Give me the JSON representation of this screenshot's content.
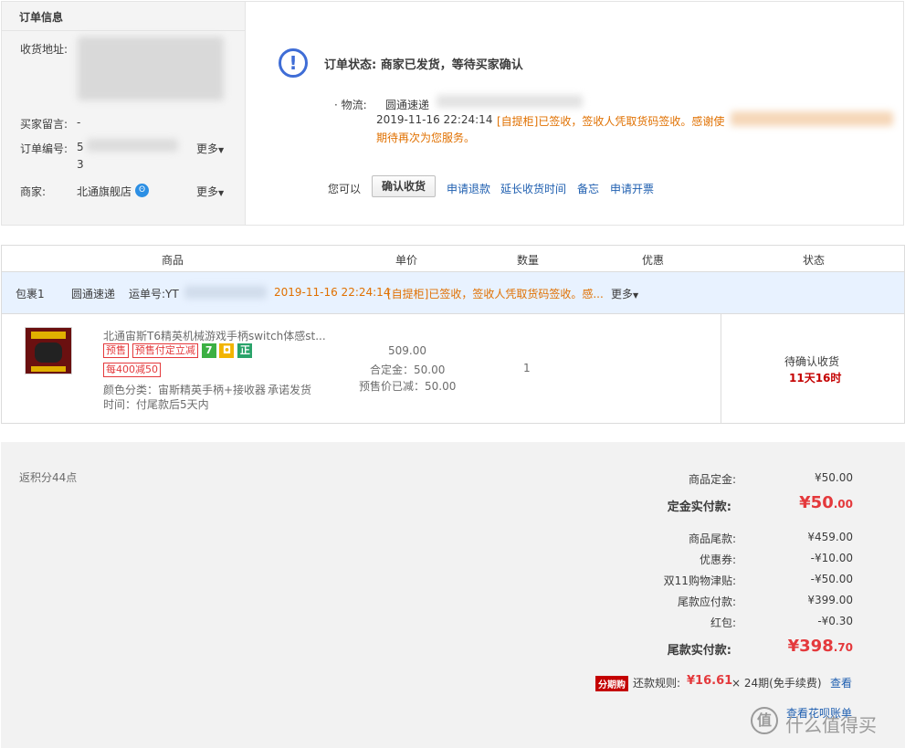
{
  "order_info": {
    "title": "订单信息",
    "address_label": "收货地址:",
    "message_label": "买家留言:",
    "message_value": "-",
    "order_no_label": "订单编号:",
    "order_no_prefix": "5",
    "order_no_tail": "3",
    "more_label": "更多",
    "seller_label": "商家:",
    "seller_value": "北通旗舰店",
    "seller_more": "更多"
  },
  "status": {
    "title": "订单状态: 商家已发货，等待买家确认",
    "logistics_label": "· 物流:",
    "logistics_company": "圆通速递",
    "logistics_time": "2019-11-16 22:24:14",
    "logistics_msg": "[自提柜]已签收，签收人凭取货码签收。感谢使",
    "logistics_msg2": "期待再次为您服务。",
    "you_can": "您可以",
    "confirm_button": "确认收货",
    "actions": [
      "申请退款",
      "延长收货时间",
      "备忘",
      "申请开票"
    ]
  },
  "table": {
    "headers": [
      "商品",
      "单价",
      "数量",
      "优惠",
      "状态"
    ],
    "package": {
      "label": "包裹1",
      "company": "圆通速递",
      "tracking_label": "运单号:YT",
      "time": "2019-11-16 22:24:14",
      "msg": "[自提柜]已签收，签收人凭取货码签收。感...",
      "more": "更多"
    },
    "item": {
      "name": "北通宙斯T6精英机械游戏手柄switch体感st...",
      "tag_presale": "预售",
      "tag_deposit": "预售付定立减",
      "icon7": "7",
      "iconZheng": "正",
      "promo": "每400减50",
      "spec": "颜色分类：宙斯精英手柄+接收器",
      "promise": "承诺发货",
      "time": "时间：付尾款后5天内",
      "price": "509.00",
      "deposit": "合定金：50.00",
      "presale_off": "预售价已减：50.00",
      "qty": "1",
      "status": "待确认收货",
      "countdown": "11天16时"
    }
  },
  "summary": {
    "points": "返积分44点",
    "rows": [
      {
        "label": "商品定金:",
        "value": "¥50.00"
      },
      {
        "label": "定金实付款:",
        "value_main": "¥50",
        "value_dec": ".00"
      },
      {
        "label": "商品尾款:",
        "value": "¥459.00"
      },
      {
        "label": "优惠券:",
        "value": "-¥10.00"
      },
      {
        "label": "双11购物津贴:",
        "value": "-¥50.00"
      },
      {
        "label": "尾款应付款:",
        "value": "¥399.00"
      },
      {
        "label": "红包:",
        "value": "-¥0.30"
      },
      {
        "label": "尾款实付款:",
        "value_main": "¥398",
        "value_dec": ".70"
      }
    ],
    "fenqi_badge": "分期购",
    "repay_label": "还款规则:",
    "repay_amount": "¥16.61",
    "repay_times": "× 24期(免手续费)",
    "view": "查看",
    "huabei": "查看花呗账单",
    "watermark": "什么值得买"
  }
}
